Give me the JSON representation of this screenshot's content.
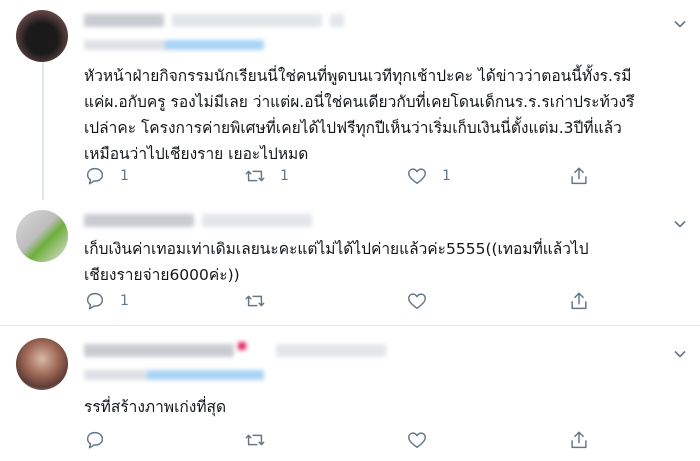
{
  "tweets": [
    {
      "text": "หัวหน้าฝ่ายกิจกรรมนักเรียนนี่ใช่คนที่พูดบนเวทีทุกเช้าปะคะ ได้ข่าวว่าตอนนี้ทั้งร.รมี\nแค่ผ.อกับครู รองไม่มีเลย ว่าแต่ผ.อนี่ใช่คนเดียวกับที่เคยโดนเด็กนร.ร.รเก่าประท้วงรึ\nเปล่าคะ โครงการค่ายพิเศษที่เคยได้ไปฟรีทุกปีเห็นว่าเริ่มเก็บเงินนี่ตั้งแต่ม.3ปีที่แล้ว\nเหมือนว่าไปเชียงราย เยอะไปหมด",
      "reply_count": "1",
      "retweet_count": "1",
      "like_count": "1"
    },
    {
      "text": "เก็บเงินค่าเทอมเท่าเดิมเลยนะคะแต่ไม่ได้ไปค่ายแล้วค่ะ5555((เทอมที่แล้วไป\nเชียงรายจ่าย6000ค่ะ))",
      "reply_count": "1",
      "retweet_count": "",
      "like_count": ""
    },
    {
      "text": "รรที่สร้างภาพเก่งที่สุด",
      "reply_count": "",
      "retweet_count": "",
      "like_count": ""
    }
  ],
  "colors": {
    "icon": "#657786",
    "blurred_name": "#d7dbe0",
    "blurred_link": "#a9d4f5"
  }
}
